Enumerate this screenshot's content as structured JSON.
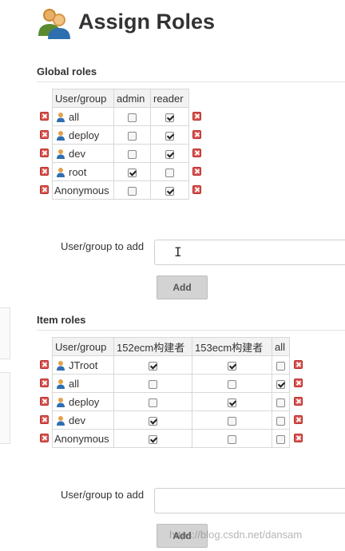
{
  "page": {
    "title": "Assign Roles"
  },
  "global_roles": {
    "heading": "Global roles",
    "columns": [
      "User/group",
      "admin",
      "reader"
    ],
    "rows": [
      {
        "name": "all",
        "user_icon": true,
        "checks": [
          false,
          true
        ]
      },
      {
        "name": "deploy",
        "user_icon": true,
        "checks": [
          false,
          true
        ]
      },
      {
        "name": "dev",
        "user_icon": true,
        "checks": [
          false,
          true
        ]
      },
      {
        "name": "root",
        "user_icon": true,
        "checks": [
          true,
          false
        ]
      },
      {
        "name": "Anonymous",
        "user_icon": false,
        "checks": [
          false,
          true
        ]
      }
    ],
    "add_label": "User/group to add",
    "add_input_value": "",
    "add_button": "Add"
  },
  "item_roles": {
    "heading": "Item roles",
    "columns": [
      "User/group",
      "152ecm构建者",
      "153ecm构建者",
      "all"
    ],
    "rows": [
      {
        "name": "JTroot",
        "user_icon": true,
        "checks": [
          true,
          true,
          false
        ]
      },
      {
        "name": "all",
        "user_icon": true,
        "checks": [
          false,
          false,
          true
        ]
      },
      {
        "name": "deploy",
        "user_icon": true,
        "checks": [
          false,
          true,
          false
        ]
      },
      {
        "name": "dev",
        "user_icon": true,
        "checks": [
          true,
          false,
          false
        ]
      },
      {
        "name": "Anonymous",
        "user_icon": false,
        "checks": [
          true,
          false,
          false
        ]
      }
    ],
    "add_label": "User/group to add",
    "add_input_value": "",
    "add_button": "Add"
  },
  "watermark": "https://blog.csdn.net/dansam",
  "icons": {
    "logo": "users-group-icon",
    "user": "user-icon",
    "delete": "delete-x-icon",
    "checkbox": "checkbox"
  },
  "colors": {
    "delete": "#d9534f",
    "header_bg": "#f2f2f2",
    "button_bg": "#d3d3d3"
  }
}
